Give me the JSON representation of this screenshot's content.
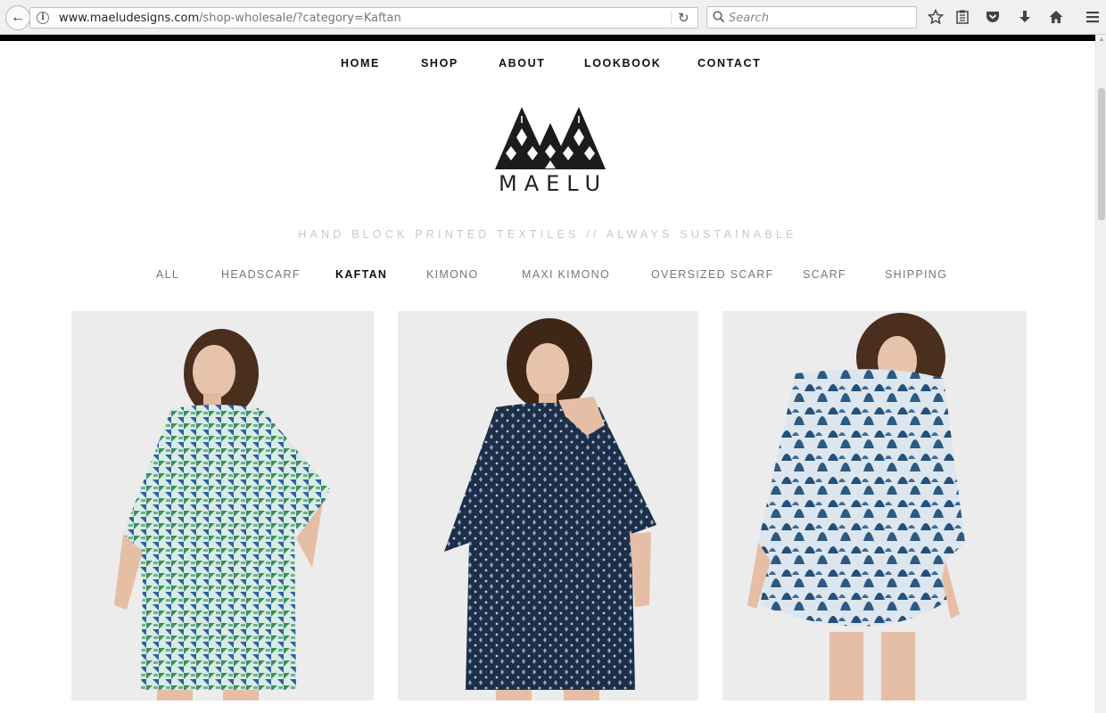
{
  "browser": {
    "url_domain": "www.maeludesigns.com",
    "url_path": "/shop-wholesale/?category=Kaftan",
    "search_placeholder": "Search"
  },
  "nav": {
    "items": [
      "HOME",
      "SHOP",
      "ABOUT",
      "LOOKBOOK",
      "CONTACT"
    ]
  },
  "brand": {
    "name": "MAELU",
    "tagline": "HAND BLOCK PRINTED TEXTILES // ALWAYS SUSTAINABLE"
  },
  "categories": {
    "items": [
      "ALL",
      "HEADSCARF",
      "KAFTAN",
      "KIMONO",
      "MAXI KIMONO",
      "OVERSIZED SCARF",
      "SCARF",
      "SHIPPING"
    ],
    "active": "KAFTAN"
  },
  "products": [
    {
      "image": "model-in-green-geometric-kaftan",
      "color": "#3f8a6a"
    },
    {
      "image": "model-in-navy-block-print-kaftan",
      "color": "#1f3550"
    },
    {
      "image": "model-in-blue-leaf-print-kaftan",
      "color": "#2c5a82"
    }
  ]
}
